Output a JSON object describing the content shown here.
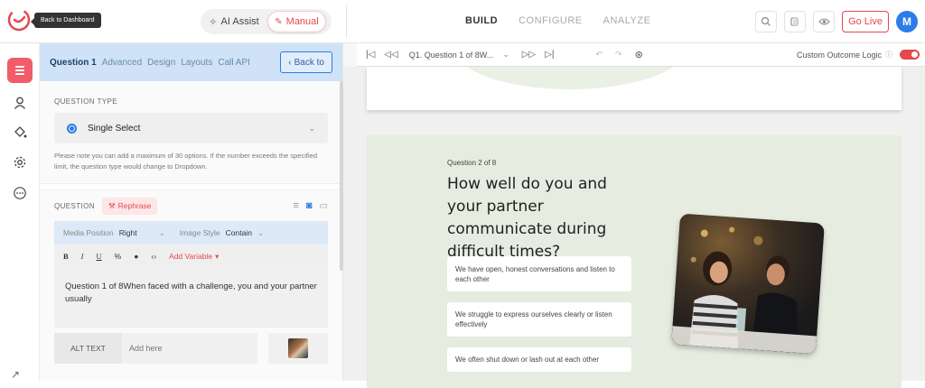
{
  "topbar": {
    "tooltip": "Back to Dashboard",
    "ai_assist_label": "AI Assist",
    "manual_label": "Manual",
    "tabs": [
      "BUILD",
      "CONFIGURE",
      "ANALYZE"
    ],
    "go_live_label": "Go Live",
    "avatar_initial": "M"
  },
  "panel": {
    "tabs": [
      "Question 1",
      "Advanced",
      "Design",
      "Layouts",
      "Call API"
    ],
    "back_label": "Back to",
    "question_type_label": "QUESTION TYPE",
    "question_type_value": "Single Select",
    "note": "Please note you can add a maximum of 30 options. If the number exceeds the specified limit, the question type would change to Dropdown.",
    "question_label": "QUESTION",
    "rephrase_label": "Rephrase",
    "media_position_label": "Media Position",
    "media_position_value": "Right",
    "image_style_label": "Image Style",
    "image_style_value": "Contain",
    "add_variable_label": "Add Variable",
    "question_text": "Question 1 of 8When faced with a challenge, you and your partner usually",
    "alt_text_label": "ALT TEXT",
    "alt_text_placeholder": "Add here"
  },
  "canvas_toolbar": {
    "question_select": "Q1. Question 1 of 8W...",
    "custom_outcome_label": "Custom Outcome Logic"
  },
  "preview": {
    "question_meta": "Question 2 of 8",
    "question_title": "How well do you and your partner communicate during difficult times?",
    "options": [
      "We have open, honest conversations and listen to each other",
      "We struggle to express ourselves clearly or listen effectively",
      "We often shut down or lash out at each other"
    ]
  },
  "colors": {
    "brand": "#e5484d",
    "accent": "#2b7de9",
    "panel_header": "#cfe2f7",
    "preview_bg": "#e6ecdf"
  }
}
